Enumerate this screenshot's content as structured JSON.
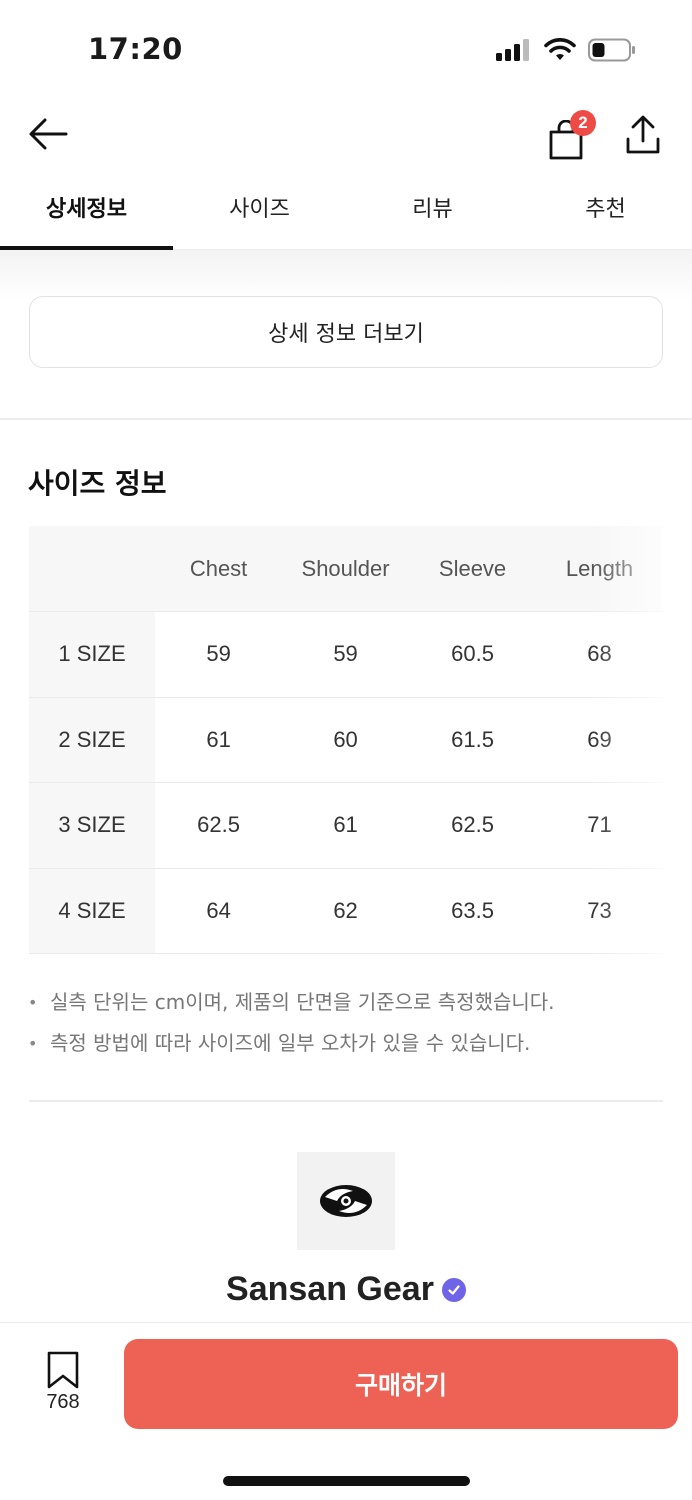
{
  "status_bar": {
    "time": "17:20"
  },
  "header": {
    "cart_count": "2"
  },
  "tabs": [
    {
      "label": "상세정보",
      "active": true
    },
    {
      "label": "사이즈",
      "active": false
    },
    {
      "label": "리뷰",
      "active": false
    },
    {
      "label": "추천",
      "active": false
    }
  ],
  "more_info_button": "상세 정보 더보기",
  "size_section": {
    "title": "사이즈 정보",
    "columns": [
      "Chest",
      "Shoulder",
      "Sleeve",
      "Length"
    ],
    "rows": [
      {
        "size": "1 SIZE",
        "values": [
          "59",
          "59",
          "60.5",
          "68"
        ]
      },
      {
        "size": "2 SIZE",
        "values": [
          "61",
          "60",
          "61.5",
          "69"
        ]
      },
      {
        "size": "3 SIZE",
        "values": [
          "62.5",
          "61",
          "62.5",
          "71"
        ]
      },
      {
        "size": "4 SIZE",
        "values": [
          "64",
          "62",
          "63.5",
          "73"
        ]
      }
    ],
    "notes": [
      "실측 단위는 cm이며, 제품의 단면을 기준으로 측정했습니다.",
      "측정 방법에 따라 사이즈에 일부 오차가 있을 수 있습니다."
    ]
  },
  "brand": {
    "name": "Sansan Gear",
    "verified": true,
    "logo_icon": "brand-swirl-logo"
  },
  "bottom_bar": {
    "bookmark_count": "768",
    "buy_label": "구매하기"
  },
  "colors": {
    "accent": "#ee6155",
    "badge": "#ef4b46",
    "verified": "#6f63e8"
  }
}
